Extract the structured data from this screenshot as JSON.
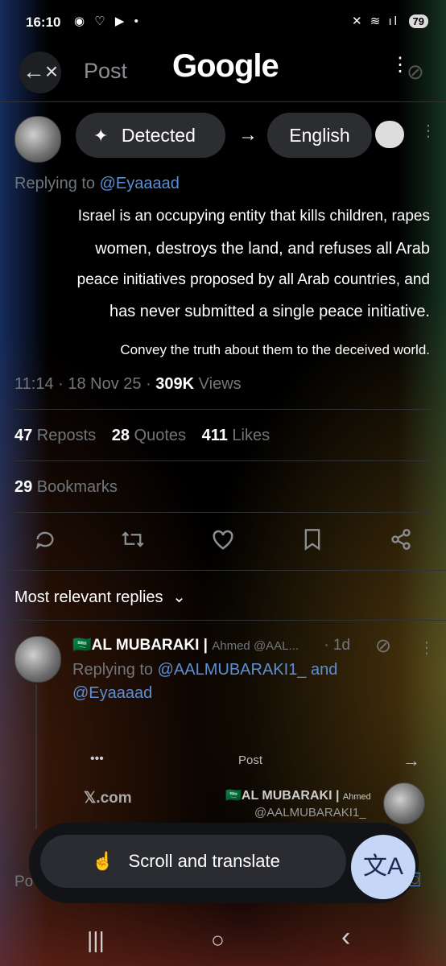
{
  "status_bar": {
    "time": "16:10",
    "left_icons": "◉ ♡ ▶ •",
    "right_icons": "✕ ≋ ıl",
    "battery": "79"
  },
  "header": {
    "back_icon": "←×",
    "title": "Post",
    "brand": "Google",
    "menu_icon": "⋮"
  },
  "translate_bar": {
    "detected_label": "Detected",
    "arrow": "→",
    "target_language": "English"
  },
  "post": {
    "replying_prefix": "Replying to",
    "replying_handle": "@Eyaaaad",
    "lines": [
      "Israel is an occupying entity that kills children, rapes",
      "women, destroys the land, and refuses all Arab",
      "peace initiatives proposed by all Arab countries, and",
      "has never submitted a single peace initiative.",
      "Convey the truth about them to the deceived world."
    ],
    "meta_time": "11:14 · 18 Nov 25 · ",
    "views_count": "309K",
    "views_label": " Views",
    "reposts_count": "47",
    "reposts_label": " Reposts",
    "quotes_count": "28",
    "quotes_label": " Quotes",
    "likes_count": "411",
    "likes_label": " Likes",
    "bookmarks_count": "29",
    "bookmarks_label": " Bookmarks"
  },
  "replies": {
    "sort_label": "Most relevant replies",
    "chevron": "⌄",
    "reply": {
      "flag": "🇸🇦",
      "name": "AL MUBARAKI | ",
      "handle": "Ahmed @AAL...",
      "time": "· 1d",
      "replying_prefix": "Replying to ",
      "replying_handle1": "@AALMUBARAKI1_",
      "and": " and",
      "replying_handle2": "@Eyaaaad"
    },
    "embed": {
      "more": "•••",
      "post_label": "Post",
      "arrow": "→",
      "site": "𝕏.com",
      "name": "AL MUBARAKI | ",
      "name_suffix": "Ahmed",
      "handle": "@AALMUBARAKI1_"
    }
  },
  "composer": {
    "placeholder_start": "Po",
    "scroll_translate_label": "Scroll and translate",
    "translate_icon": "文A"
  },
  "navbar": {
    "recents": "|||",
    "home": "○",
    "back": "‹"
  },
  "colors": {
    "accent_link": "#5b8fd6",
    "muted": "#71767b",
    "translate_button": "#c6d6f7"
  }
}
